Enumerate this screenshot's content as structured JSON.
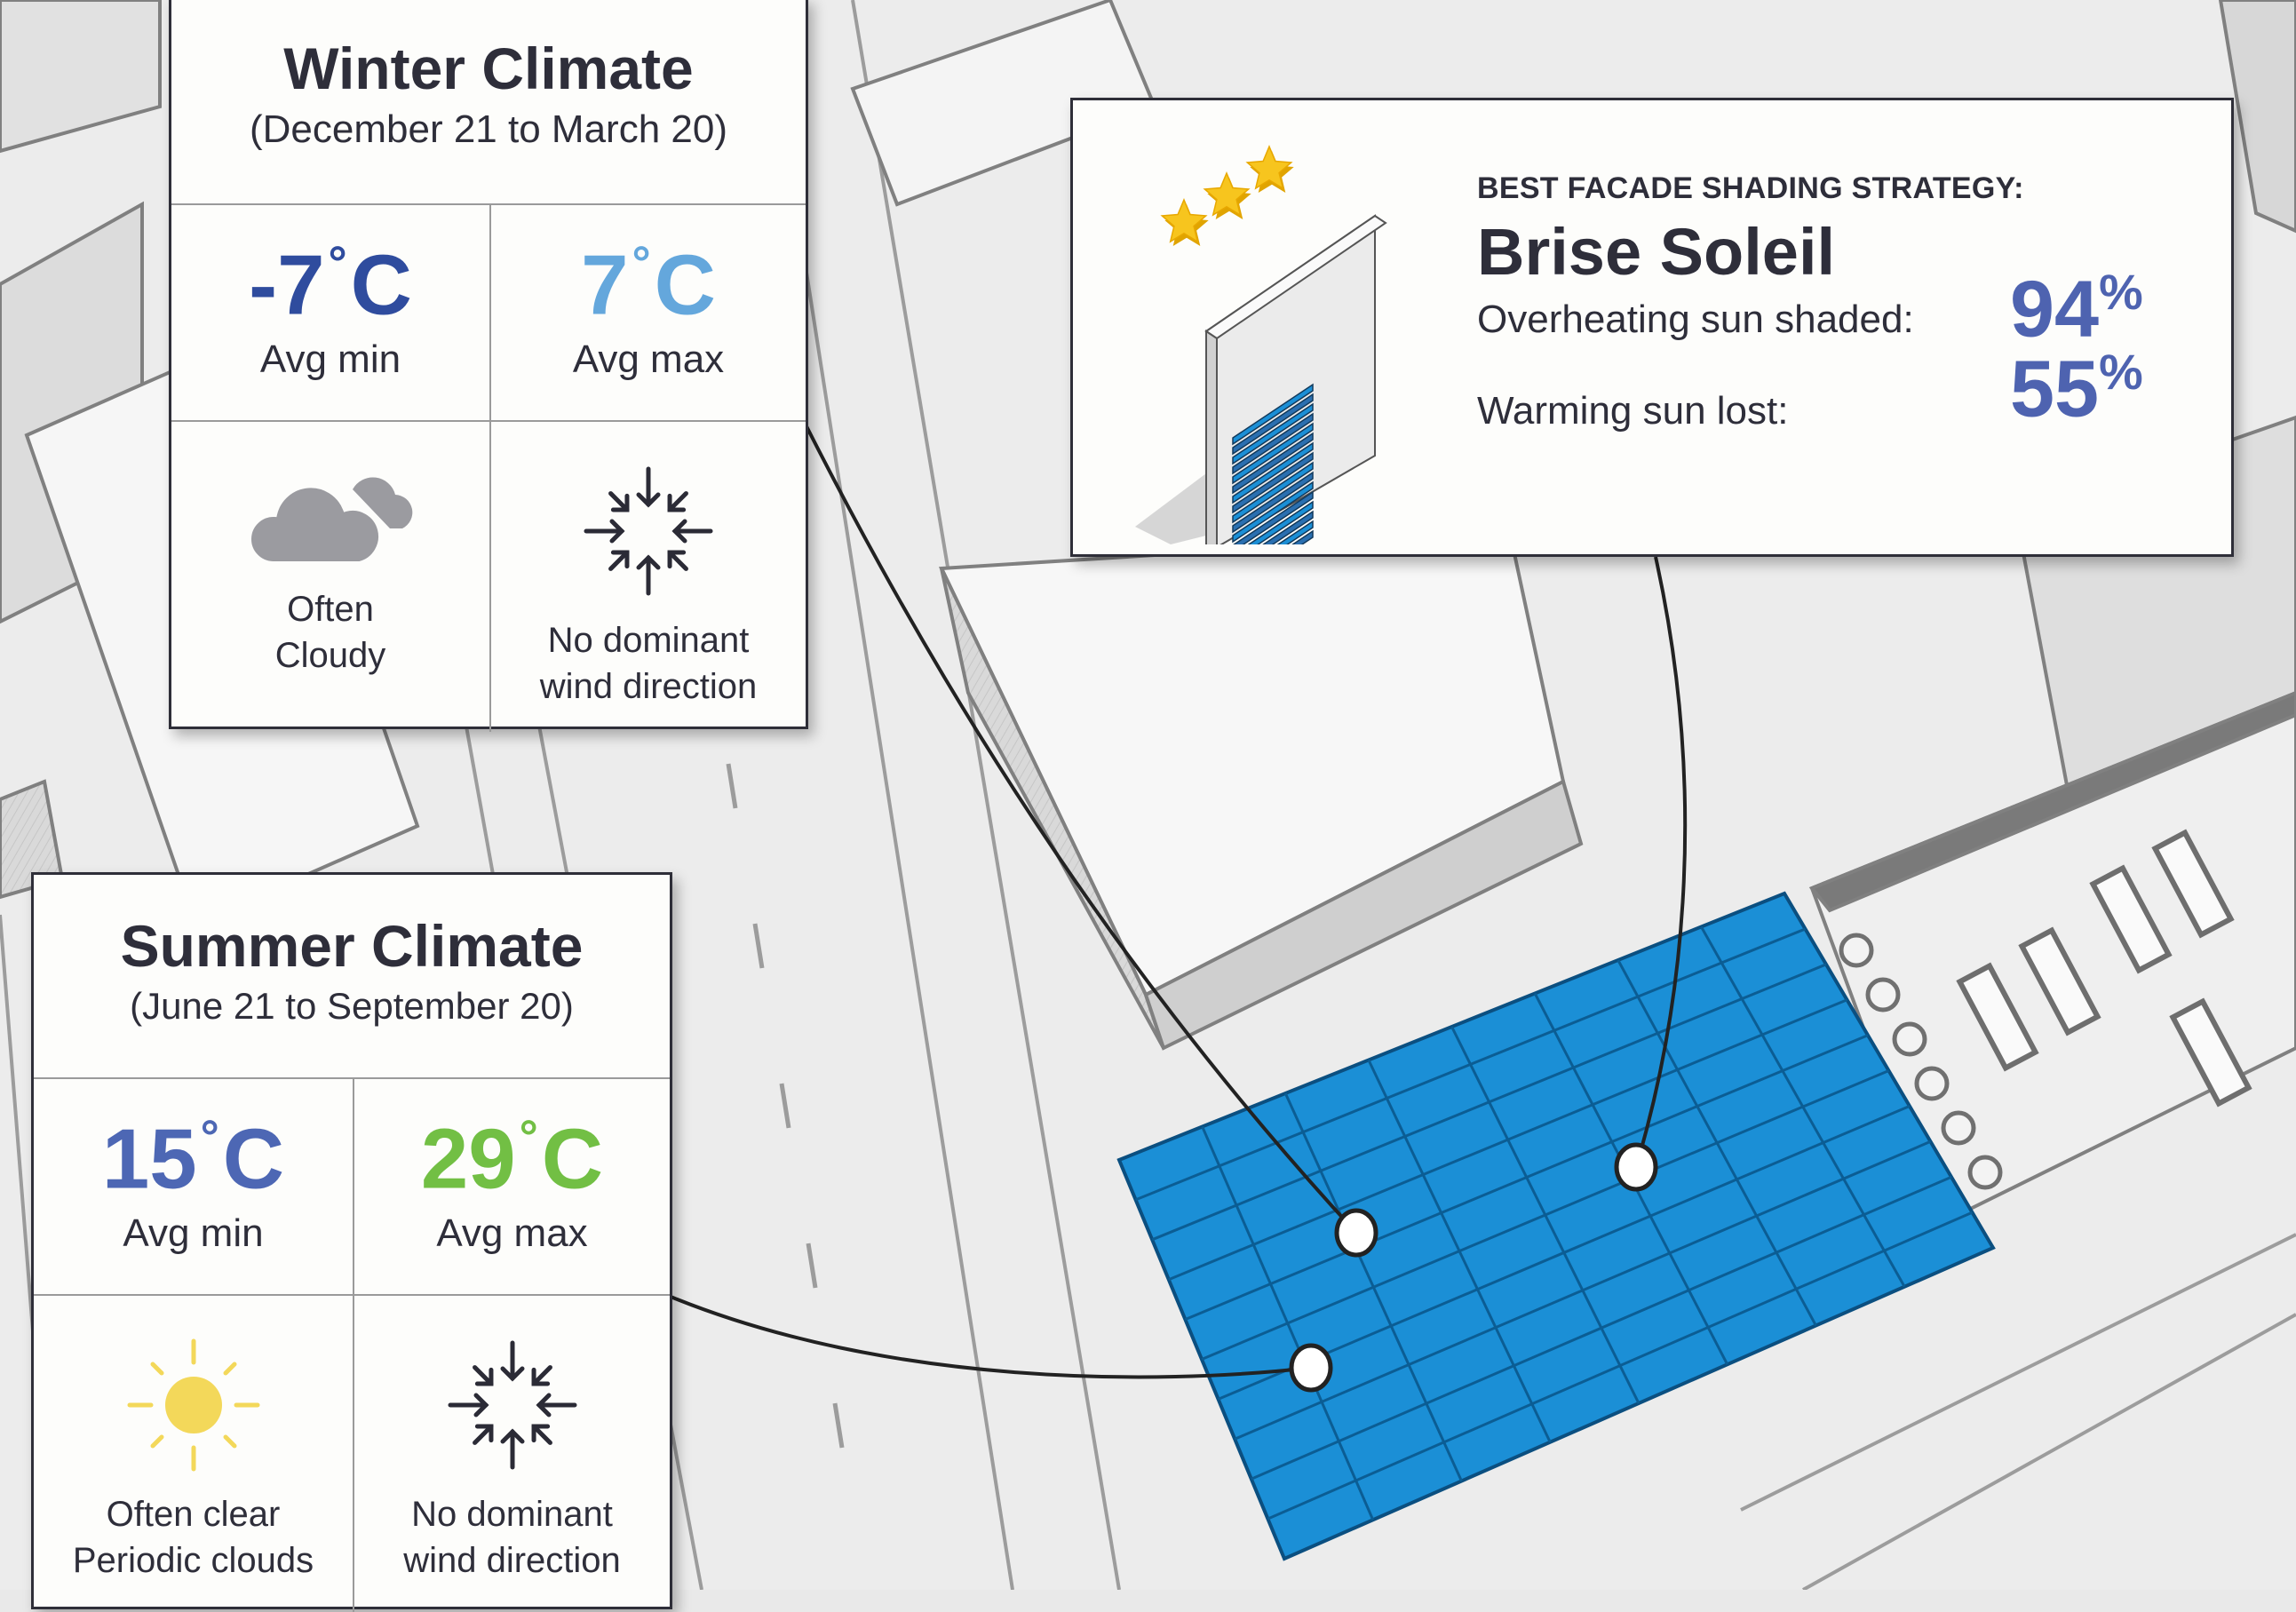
{
  "winter": {
    "title": "Winter Climate",
    "period": "(December 21 to March 20)",
    "avg_min": {
      "value": "-7",
      "unit": "C",
      "label": "Avg min",
      "color": "#2f4c9e"
    },
    "avg_max": {
      "value": "7",
      "unit": "C",
      "label": "Avg max",
      "color": "#64a7dc"
    },
    "sky": {
      "icon": "cloud-icon",
      "line1": "Often",
      "line2": "Cloudy"
    },
    "wind": {
      "icon": "converging-arrows-icon",
      "line1": "No dominant",
      "line2": "wind direction"
    }
  },
  "summer": {
    "title": "Summer Climate",
    "period": "(June 21 to September 20)",
    "avg_min": {
      "value": "15",
      "unit": "C",
      "label": "Avg min",
      "color": "#4d67b4"
    },
    "avg_max": {
      "value": "29",
      "unit": "C",
      "label": "Avg max",
      "color": "#72bf44"
    },
    "sky": {
      "icon": "sun-icon",
      "line1": "Often clear",
      "line2": "Periodic clouds"
    },
    "wind": {
      "icon": "converging-arrows-icon",
      "line1": "No dominant",
      "line2": "wind direction"
    }
  },
  "facade": {
    "kicker": "BEST FACADE SHADING STRATEGY:",
    "strategy": "Brise Soleil",
    "rating_stars": 3,
    "metrics": [
      {
        "label": "Overheating sun shaded:",
        "value": "94",
        "unit": "%"
      },
      {
        "label": "Warming sun lost:",
        "value": "55",
        "unit": "%"
      }
    ],
    "accent": "#4e63b0"
  },
  "site": {
    "highlight_color": "#1b8fd6",
    "grid_line_color": "#0b5d94",
    "callout_markers": [
      "winter-marker",
      "facade-marker",
      "summer-marker"
    ]
  }
}
